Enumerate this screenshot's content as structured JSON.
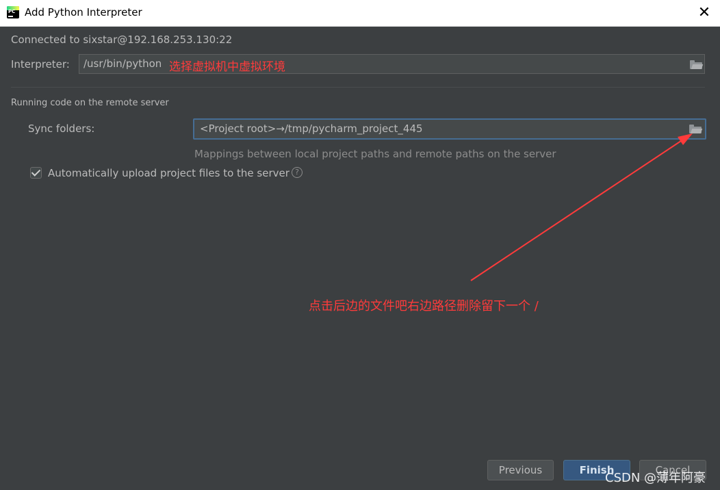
{
  "window": {
    "title": "Add Python Interpreter",
    "app_icon": "pycharm-logo-icon",
    "close_icon": "close-icon",
    "close_glyph": "✕"
  },
  "connection": {
    "text": "Connected to sixstar@192.168.253.130:22"
  },
  "interpreter": {
    "label": "Interpreter:",
    "value": "/usr/bin/python",
    "note": "选择虚拟机中虚拟环境"
  },
  "section": {
    "title": "Running code on the remote server"
  },
  "sync": {
    "label": "Sync folders:",
    "value": "<Project root>→/tmp/pycharm_project_445",
    "hint": "Mappings between local project paths and remote paths on the server"
  },
  "auto_upload": {
    "label": "Automatically upload project files to the server",
    "checked": true,
    "help_glyph": "?"
  },
  "annotation": {
    "text": "点击后边的文件吧右边路径删除留下一个  /",
    "color": "#ff3b3b"
  },
  "buttons": {
    "previous": "Previous",
    "finish": "Finish",
    "cancel": "Cancel"
  },
  "watermark": "CSDN @薄年阿豪",
  "colors": {
    "background": "#3c3f41",
    "accent": "#365880",
    "annotation": "#ff3b3b"
  }
}
